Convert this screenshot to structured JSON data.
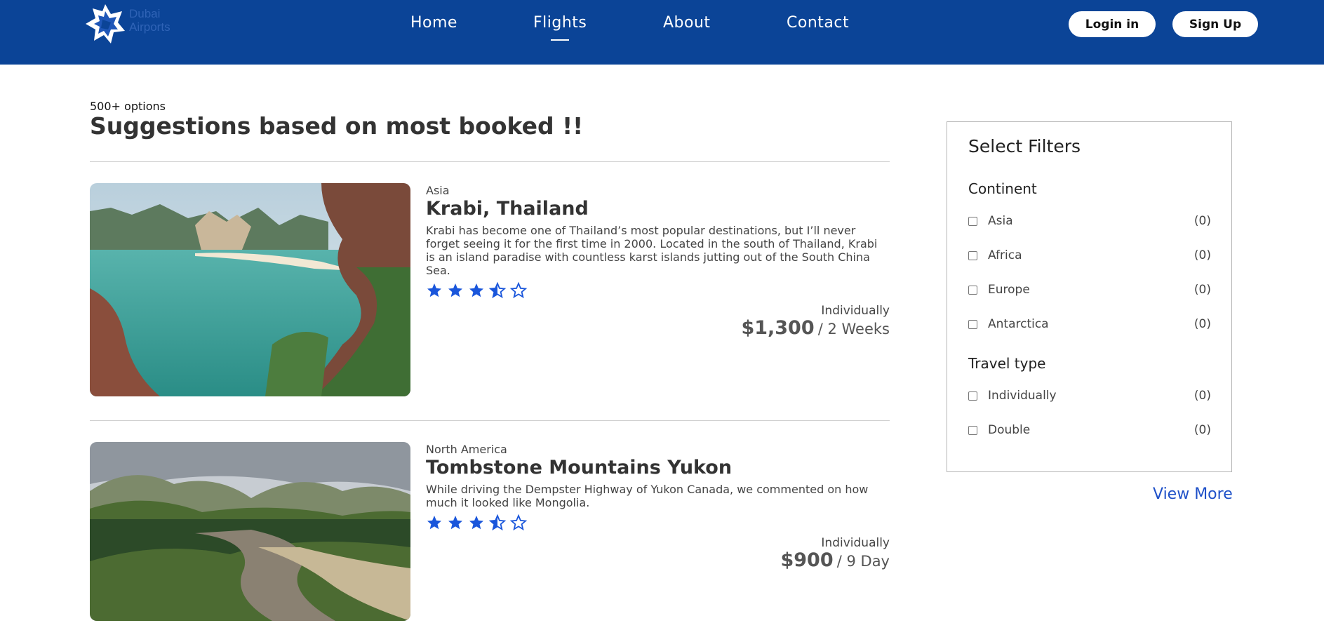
{
  "brand": {
    "logo_text_line1": "Dubai",
    "logo_text_line2": "Airports"
  },
  "nav": {
    "items": [
      {
        "label": "Home"
      },
      {
        "label": "Flights",
        "active": true
      },
      {
        "label": "About"
      },
      {
        "label": "Contact"
      }
    ],
    "login_label": "Login in",
    "signup_label": "Sign Up"
  },
  "main": {
    "options_count": "500+ options",
    "title": "Suggestions based on most booked !!"
  },
  "destinations": [
    {
      "region": "Asia",
      "title": "Krabi, Thailand",
      "description": "Krabi has become one of Thailand’s most popular destinations, but I’ll never forget seeing it for the first time in 2000. Located in the south of Thailand, Krabi is an island paradise with countless karst islands jutting out of the South China Sea.",
      "rating": 3.5,
      "rating_max": 5,
      "pricing_type": "Individually",
      "price": "$1,300",
      "duration": "/ 2 Weeks"
    },
    {
      "region": "North America",
      "title": "Tombstone Mountains Yukon",
      "description": "While driving the Dempster Highway of Yukon Canada, we commented on how much it looked like Mongolia.",
      "rating": 3.5,
      "rating_max": 5,
      "pricing_type": "Individually",
      "price": "$900",
      "duration": "/ 9 Day"
    }
  ],
  "filters": {
    "title": "Select Filters",
    "continent_label": "Continent",
    "continents": [
      {
        "label": "Asia",
        "count": "(0)"
      },
      {
        "label": "Africa",
        "count": "(0)"
      },
      {
        "label": "Europe",
        "count": "(0)"
      },
      {
        "label": "Antarctica",
        "count": "(0)"
      }
    ],
    "travel_type_label": "Travel type",
    "travel_types": [
      {
        "label": "Individually",
        "count": "(0)"
      },
      {
        "label": "Double",
        "count": "(0)"
      }
    ],
    "view_more_label": "View More"
  },
  "colors": {
    "header_bg": "#0b4497",
    "star": "#1a56db",
    "link": "#1e50c8"
  },
  "icons": {
    "logo": "dubai-airports-logo",
    "star_full": "star-icon",
    "star_half": "star-half-icon",
    "star_empty": "star-outline-icon"
  }
}
